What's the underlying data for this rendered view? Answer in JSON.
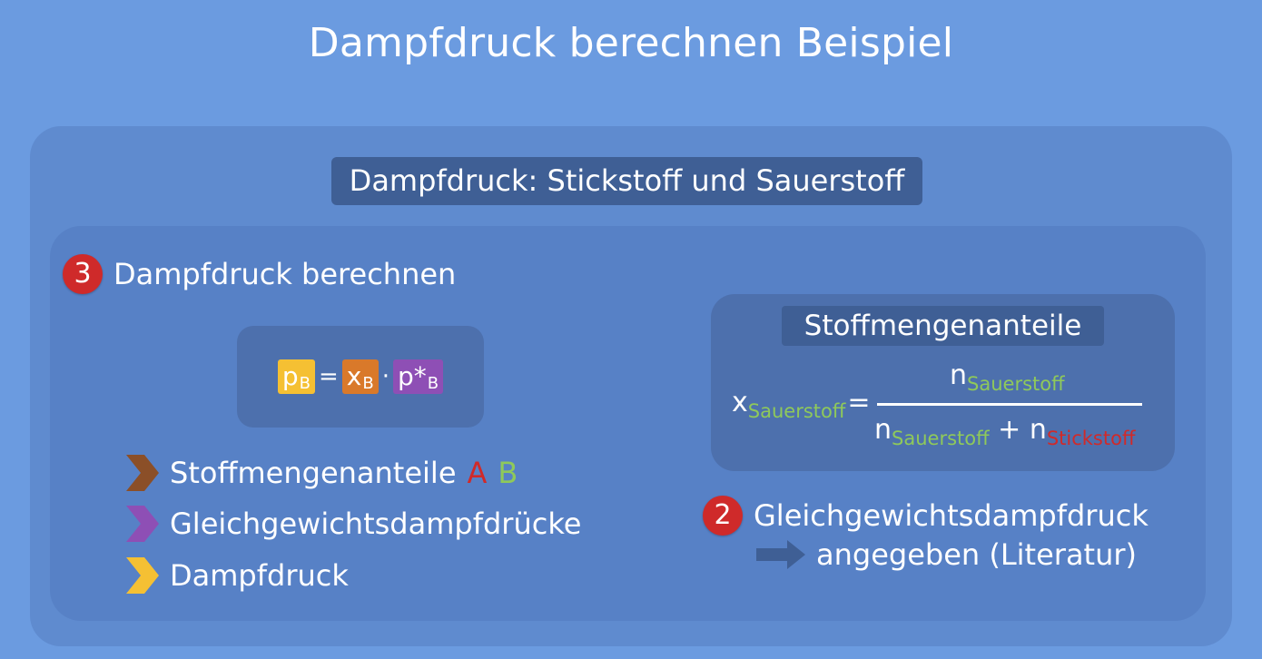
{
  "title": "Dampfdruck berechnen Beispiel",
  "subtitle": "Dampfdruck: Stickstoff und Sauerstoff",
  "step3": {
    "number": "3",
    "label": "Dampfdruck berechnen"
  },
  "formula": {
    "p": "p",
    "p_sub": "B",
    "equals": "=",
    "x": "x",
    "x_sub": "B",
    "dot": "·",
    "pstar": "p*",
    "pstar_sub": "B",
    "colors": {
      "p": "#f5c033",
      "x": "#d9792a",
      "pstar": "#8e4fb5"
    }
  },
  "legend": [
    {
      "label": "Stoffmengenanteile",
      "extra_a": "A",
      "extra_b": "B",
      "icon": "chevron-right-icon",
      "color": "#8b4f28"
    },
    {
      "label": "Gleichgewichtsdampfdrücke",
      "icon": "chevron-right-icon",
      "color": "#8e4fb5"
    },
    {
      "label": "Dampfdruck",
      "icon": "chevron-right-icon",
      "color": "#f5c033"
    }
  ],
  "legend_accent": {
    "a_color": "#d02a2a",
    "b_color": "#8fc95a"
  },
  "stoffmengenanteile": {
    "title": "Stoffmengenanteile",
    "x": "x",
    "x_sub": "Sauerstoff",
    "equals": "=",
    "numerator": "n",
    "numerator_sub": "Sauerstoff",
    "den_n1": "n",
    "den_n1_sub": "Sauerstoff",
    "plus": "+",
    "den_n2": "n",
    "den_n2_sub": "Stickstoff"
  },
  "step2": {
    "number": "2",
    "label": "Gleichgewichtsdampfdruck",
    "arrow_text": "angegeben (Literatur)",
    "arrow_icon": "arrow-right-icon"
  }
}
